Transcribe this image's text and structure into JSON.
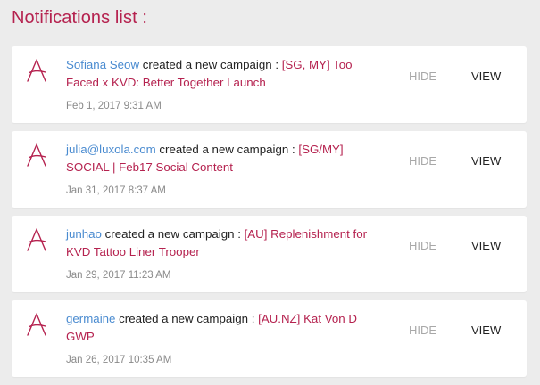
{
  "page": {
    "title": "Notifications list :"
  },
  "colors": {
    "accent": "#b5224f",
    "user": "#4a8bd0",
    "muted": "#a8a8a8",
    "background": "#ececec"
  },
  "notifications": [
    {
      "icon": "brand-a-logo-icon",
      "user": "Sofiana Seow",
      "action": " created a new campaign : ",
      "campaign_line1": "[SG, MY] Too",
      "campaign_line2": "Faced x KVD: Better Together Launch",
      "campaign": "[SG, MY] Too Faced x KVD: Better Together Launch",
      "timestamp": "Feb 1, 2017 9:31 AM",
      "hide_label": "HIDE",
      "view_label": "VIEW"
    },
    {
      "icon": "brand-a-logo-icon",
      "user": "julia@luxola.com",
      "action": " created a new campaign : ",
      "campaign_line1": "[SG/MY]",
      "campaign_line2": "SOCIAL | Feb17 Social Content",
      "campaign": "[SG/MY] SOCIAL | Feb17 Social Content",
      "timestamp": "Jan 31, 2017 8:37 AM",
      "hide_label": "HIDE",
      "view_label": "VIEW"
    },
    {
      "icon": "brand-a-logo-icon",
      "user": "junhao",
      "action": " created a new campaign : ",
      "campaign_line1": "[AU] Replenishment for",
      "campaign_line2": "KVD Tattoo Liner Trooper",
      "campaign": "[AU] Replenishment for KVD Tattoo Liner Trooper",
      "timestamp": "Jan 29, 2017 11:23 AM",
      "hide_label": "HIDE",
      "view_label": "VIEW"
    },
    {
      "icon": "brand-a-logo-icon",
      "user": "germaine",
      "action": " created a new campaign : ",
      "campaign_line1": "[AU.NZ] Kat Von D",
      "campaign_line2": "GWP",
      "campaign": "[AU.NZ] Kat Von D GWP",
      "timestamp": "Jan 26, 2017 10:35 AM",
      "hide_label": "HIDE",
      "view_label": "VIEW"
    }
  ]
}
